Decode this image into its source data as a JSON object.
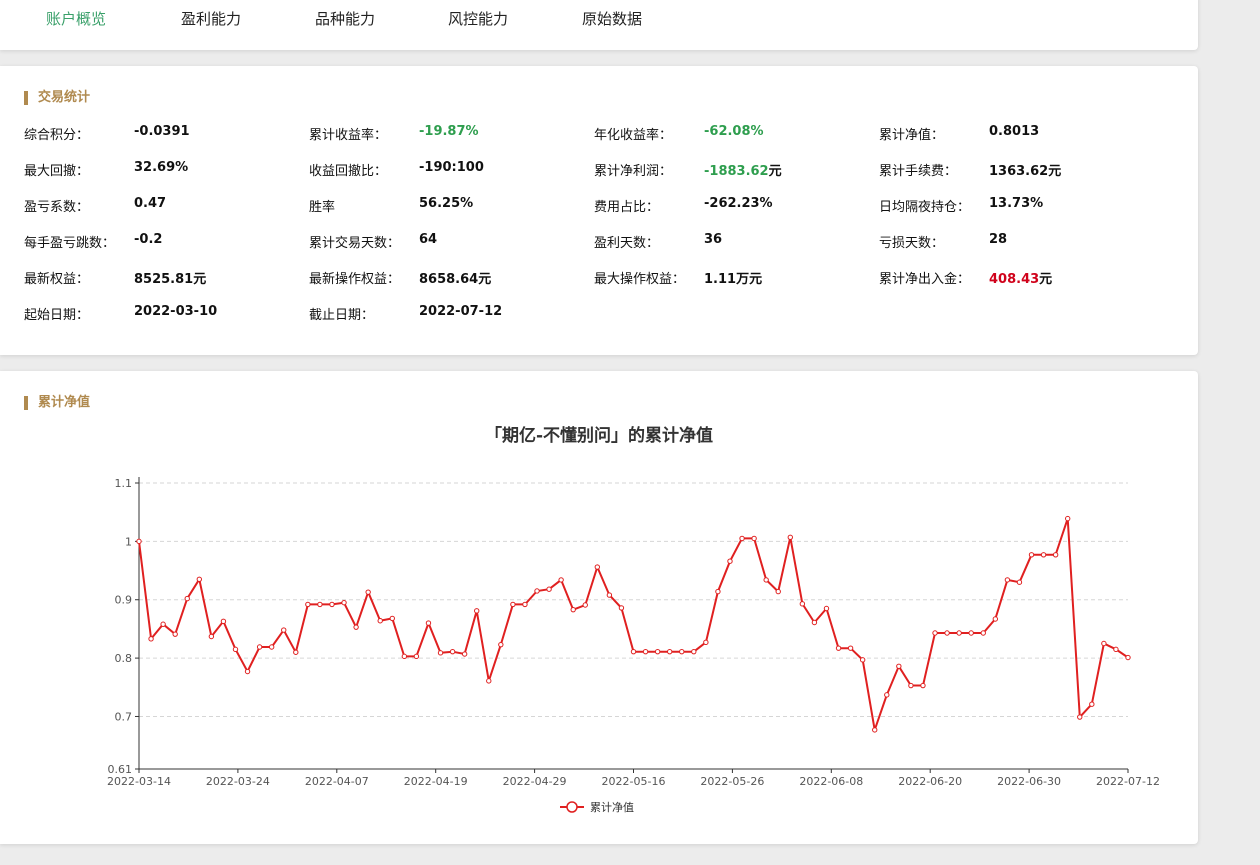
{
  "tabs": [
    "账户概览",
    "盈利能力",
    "品种能力",
    "风控能力",
    "原始数据"
  ],
  "active_tab": 0,
  "stats_section_title": "交易统计",
  "stats": [
    {
      "label": "综合积分：",
      "value": "-0.0391",
      "color": ""
    },
    {
      "label": "累计收益率：",
      "value": "-19.87%",
      "color": "green"
    },
    {
      "label": "年化收益率：",
      "value": "-62.08%",
      "color": "green"
    },
    {
      "label": "累计净值：",
      "value": "0.8013",
      "color": ""
    },
    {
      "label": "最大回撤：",
      "value": "32.69%",
      "color": ""
    },
    {
      "label": "收益回撤比：",
      "value": "-190:100",
      "color": ""
    },
    {
      "label": "累计净利润：",
      "value": "-1883.62",
      "color": "green",
      "unit": "元"
    },
    {
      "label": "累计手续费：",
      "value": "1363.62",
      "color": "",
      "unit": "元"
    },
    {
      "label": "盈亏系数：",
      "value": "0.47",
      "color": ""
    },
    {
      "label": "胜率",
      "value": "56.25%",
      "color": ""
    },
    {
      "label": "费用占比：",
      "value": "-262.23%",
      "color": ""
    },
    {
      "label": "日均隔夜持仓：",
      "value": "13.73%",
      "color": ""
    },
    {
      "label": "每手盈亏跳数：",
      "value": "-0.2",
      "color": ""
    },
    {
      "label": "累计交易天数：",
      "value": "64",
      "color": ""
    },
    {
      "label": "盈利天数：",
      "value": "36",
      "color": ""
    },
    {
      "label": "亏损天数：",
      "value": "28",
      "color": ""
    },
    {
      "label": "最新权益：",
      "value": "8525.81",
      "color": "",
      "unit": "元"
    },
    {
      "label": "最新操作权益：",
      "value": "8658.64",
      "color": "",
      "unit": "元"
    },
    {
      "label": "最大操作权益：",
      "value": "1.11万",
      "color": "",
      "unit": "元"
    },
    {
      "label": "累计净出入金：",
      "value": "408.43",
      "color": "red",
      "unit": "元"
    },
    {
      "label": "起始日期：",
      "value": "2022-03-10",
      "color": ""
    },
    {
      "label": "截止日期：",
      "value": "2022-07-12",
      "color": ""
    }
  ],
  "chart_section_title": "累计净值",
  "chart_data": {
    "type": "line",
    "title": "「期亿-不懂别问」的累计净值",
    "xlabel": "",
    "ylabel": "",
    "ylim": [
      0.61,
      1.1
    ],
    "yticks": [
      0.61,
      0.7,
      0.8,
      0.9,
      1,
      1.1
    ],
    "xtick_labels": [
      "2022-03-14",
      "2022-03-24",
      "2022-04-07",
      "2022-04-19",
      "2022-04-29",
      "2022-05-16",
      "2022-05-26",
      "2022-06-08",
      "2022-06-20",
      "2022-06-30",
      "2022-07-12"
    ],
    "grid": true,
    "legend": "bottom-center",
    "color": "#e02020",
    "series": [
      {
        "name": "累计净值",
        "values": [
          1.0,
          0.833,
          0.858,
          0.841,
          0.902,
          0.935,
          0.837,
          0.863,
          0.815,
          0.777,
          0.819,
          0.819,
          0.848,
          0.81,
          0.892,
          0.892,
          0.892,
          0.895,
          0.853,
          0.913,
          0.864,
          0.868,
          0.803,
          0.803,
          0.86,
          0.809,
          0.811,
          0.807,
          0.881,
          0.761,
          0.823,
          0.892,
          0.892,
          0.915,
          0.918,
          0.934,
          0.883,
          0.891,
          0.956,
          0.908,
          0.886,
          0.811,
          0.811,
          0.811,
          0.811,
          0.811,
          0.811,
          0.827,
          0.914,
          0.966,
          1.005,
          1.005,
          0.934,
          0.914,
          1.007,
          0.893,
          0.861,
          0.885,
          0.817,
          0.817,
          0.797,
          0.677,
          0.737,
          0.786,
          0.753,
          0.753,
          0.843,
          0.843,
          0.843,
          0.843,
          0.843,
          0.867,
          0.934,
          0.93,
          0.977,
          0.977,
          0.977,
          1.039,
          0.699,
          0.721,
          0.825,
          0.815,
          0.801
        ]
      }
    ]
  }
}
